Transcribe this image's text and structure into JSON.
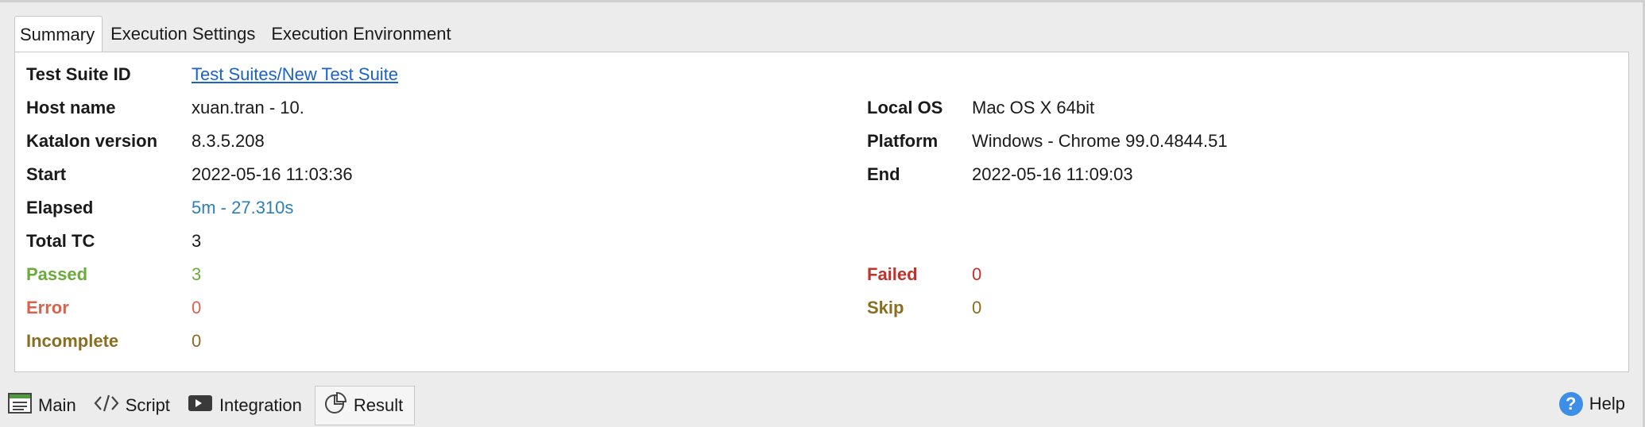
{
  "tabs": [
    {
      "label": "Summary",
      "active": true
    },
    {
      "label": "Execution Settings",
      "active": false
    },
    {
      "label": "Execution Environment",
      "active": false
    }
  ],
  "summary": {
    "test_suite_id_label": "Test Suite ID",
    "test_suite_id_value": "Test Suites/New Test Suite",
    "host_name_label": "Host name",
    "host_name_value": "xuan.tran - 10.",
    "local_os_label": "Local OS",
    "local_os_value": "Mac OS X 64bit",
    "katalon_version_label": "Katalon version",
    "katalon_version_value": "8.3.5.208",
    "platform_label": "Platform",
    "platform_value": "Windows - Chrome 99.0.4844.51",
    "start_label": "Start",
    "start_value": "2022-05-16 11:03:36",
    "end_label": "End",
    "end_value": "2022-05-16 11:09:03",
    "elapsed_label": "Elapsed",
    "elapsed_value": "5m - 27.310s",
    "total_tc_label": "Total TC",
    "total_tc_value": "3",
    "passed_label": "Passed",
    "passed_value": "3",
    "failed_label": "Failed",
    "failed_value": "0",
    "error_label": "Error",
    "error_value": "0",
    "skip_label": "Skip",
    "skip_value": "0",
    "incomplete_label": "Incomplete",
    "incomplete_value": "0"
  },
  "status_colors": {
    "passed": "#6aab3a",
    "failed": "#c0322c",
    "error": "#d9624b",
    "skip": "#8a6d1e",
    "incomplete": "#8a6d1e",
    "link": "#1b62c9"
  },
  "bottom_tabs": [
    {
      "label": "Main",
      "icon": "list-document-icon",
      "active": false
    },
    {
      "label": "Script",
      "icon": "code-brackets-icon",
      "active": false
    },
    {
      "label": "Integration",
      "icon": "integration-icon",
      "active": false
    },
    {
      "label": "Result",
      "icon": "pie-chart-icon",
      "active": true
    }
  ],
  "help": {
    "label": "Help",
    "icon": "question-circle-icon"
  }
}
